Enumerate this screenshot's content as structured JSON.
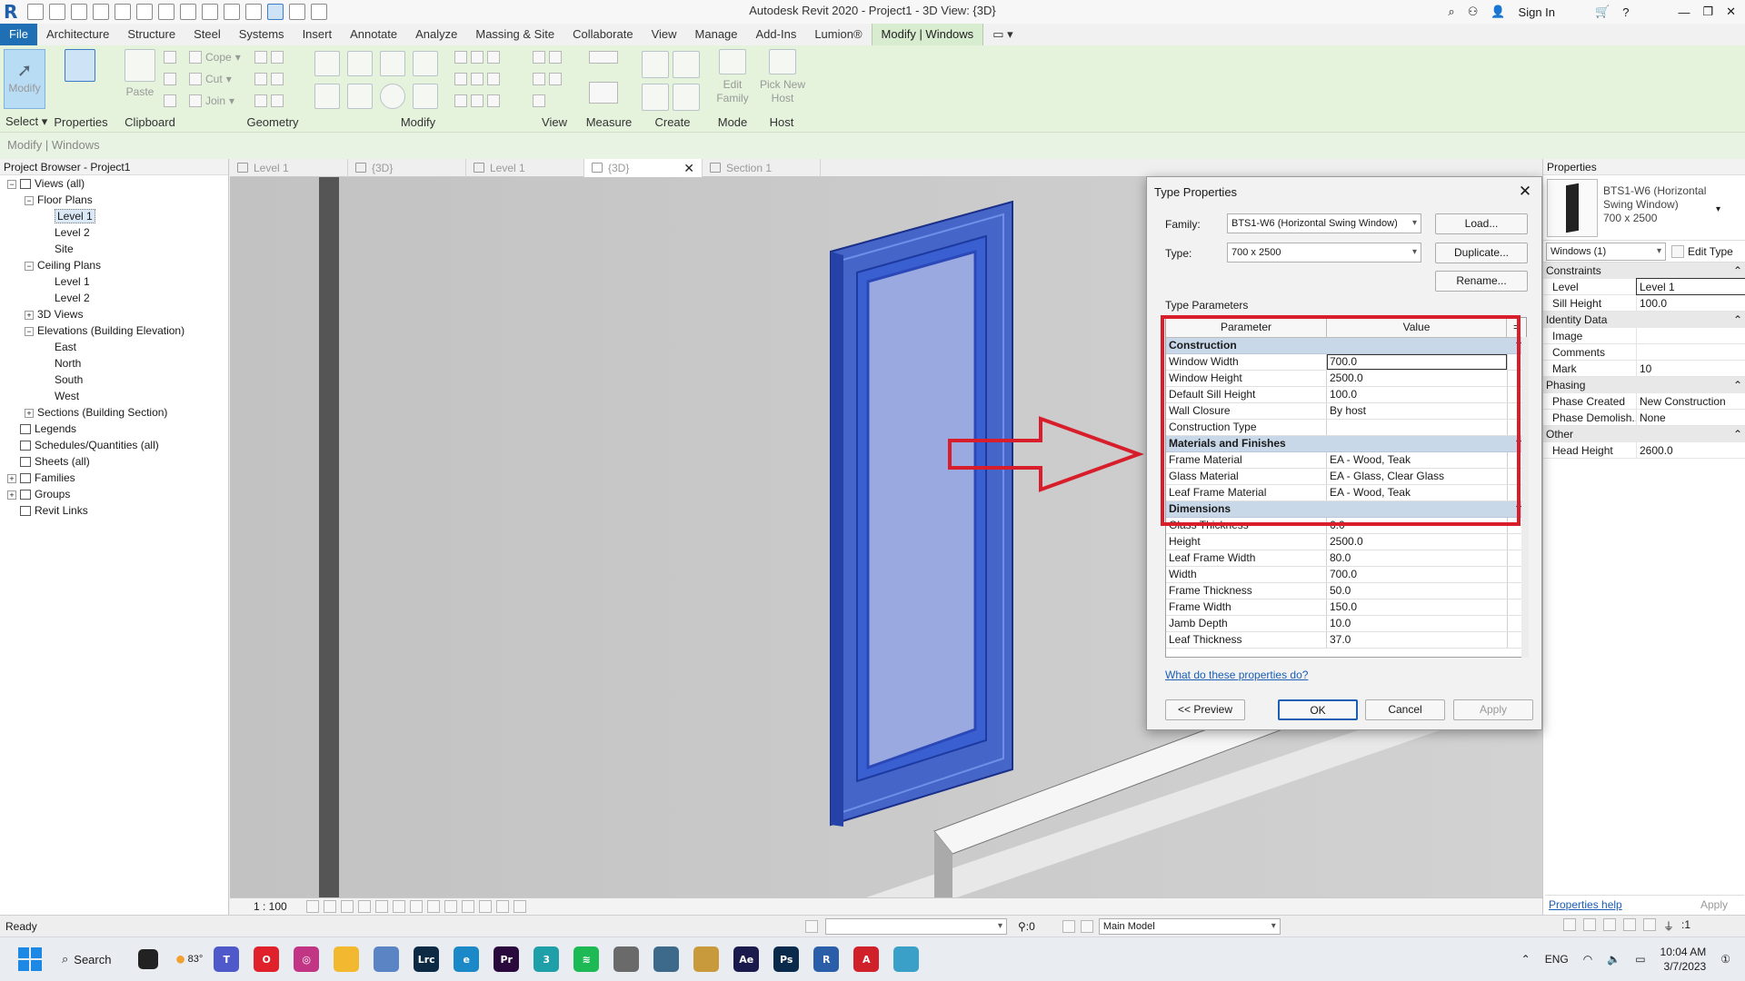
{
  "app": {
    "title": "Autodesk Revit 2020 - Project1 - 3D View: {3D}",
    "logo": "R",
    "sign_in": "Sign In"
  },
  "menu": {
    "items": [
      "File",
      "Architecture",
      "Structure",
      "Steel",
      "Systems",
      "Insert",
      "Annotate",
      "Analyze",
      "Massing & Site",
      "Collaborate",
      "View",
      "Manage",
      "Add-Ins",
      "Lumion®",
      "Modify | Windows"
    ]
  },
  "ribbon": {
    "select_label": "Select",
    "modify_btn": "Modify",
    "properties_label": "Properties",
    "paste_label": "Paste",
    "clipboard_label": "Clipboard",
    "cope": "Cope",
    "cut": "Cut",
    "join": "Join",
    "geometry_label": "Geometry",
    "modify_label": "Modify",
    "view_label": "View",
    "measure_label": "Measure",
    "create_label": "Create",
    "edit_family": "Edit Family",
    "mode_label": "Mode",
    "pick_new_host": "Pick New Host",
    "host_label": "Host"
  },
  "context_bar": "Modify | Windows",
  "project_browser": {
    "title": "Project Browser - Project1",
    "nodes": [
      {
        "label": "Views (all)",
        "level": 0,
        "exp": "−",
        "icon": true
      },
      {
        "label": "Floor Plans",
        "level": 1,
        "exp": "−"
      },
      {
        "label": "Level 1",
        "level": 2,
        "selected": true
      },
      {
        "label": "Level 2",
        "level": 2
      },
      {
        "label": "Site",
        "level": 2
      },
      {
        "label": "Ceiling Plans",
        "level": 1,
        "exp": "−"
      },
      {
        "label": "Level 1",
        "level": 2
      },
      {
        "label": "Level 2",
        "level": 2
      },
      {
        "label": "3D Views",
        "level": 1,
        "exp": "+"
      },
      {
        "label": "Elevations (Building Elevation)",
        "level": 1,
        "exp": "−"
      },
      {
        "label": "East",
        "level": 2
      },
      {
        "label": "North",
        "level": 2
      },
      {
        "label": "South",
        "level": 2
      },
      {
        "label": "West",
        "level": 2
      },
      {
        "label": "Sections (Building Section)",
        "level": 1,
        "exp": "+"
      },
      {
        "label": "Legends",
        "level": 0,
        "icon": true
      },
      {
        "label": "Schedules/Quantities (all)",
        "level": 0,
        "icon": true
      },
      {
        "label": "Sheets (all)",
        "level": 0,
        "icon": true
      },
      {
        "label": "Families",
        "level": 0,
        "exp": "+",
        "icon": true
      },
      {
        "label": "Groups",
        "level": 0,
        "exp": "+",
        "icon": true
      },
      {
        "label": "Revit Links",
        "level": 0,
        "icon": true
      }
    ]
  },
  "view_tabs": [
    "Level 1",
    "{3D}",
    "Level 1",
    "{3D}",
    "Section 1"
  ],
  "view_control": {
    "scale": "1 : 100"
  },
  "dialog": {
    "title": "Type Properties",
    "family_label": "Family:",
    "family_value": "BTS1-W6 (Horizontal Swing Window)",
    "type_label": "Type:",
    "type_value": "700 x 2500",
    "load_btn": "Load...",
    "duplicate_btn": "Duplicate...",
    "rename_btn": "Rename...",
    "type_parameters_label": "Type Parameters",
    "col_parameter": "Parameter",
    "col_value": "Value",
    "col_extra": "=",
    "sections": [
      {
        "name": "Construction",
        "rows": [
          {
            "k": "Window Width",
            "v": "700.0",
            "editing": true
          },
          {
            "k": "Window Height",
            "v": "2500.0"
          },
          {
            "k": "Default Sill Height",
            "v": "100.0"
          },
          {
            "k": "Wall Closure",
            "v": "By host"
          },
          {
            "k": "Construction Type",
            "v": ""
          }
        ]
      },
      {
        "name": "Materials and Finishes",
        "rows": [
          {
            "k": "Frame Material",
            "v": "EA - Wood, Teak"
          },
          {
            "k": "Glass Material",
            "v": "EA - Glass, Clear Glass"
          },
          {
            "k": "Leaf Frame Material",
            "v": "EA - Wood, Teak"
          }
        ]
      },
      {
        "name": "Dimensions",
        "rows": [
          {
            "k": "Glass Thickness",
            "v": "6.0"
          },
          {
            "k": "Height",
            "v": "2500.0"
          },
          {
            "k": "Leaf Frame Width",
            "v": "80.0"
          },
          {
            "k": "Width",
            "v": "700.0"
          },
          {
            "k": "Frame Thickness",
            "v": "50.0"
          },
          {
            "k": "Frame Width",
            "v": "150.0"
          },
          {
            "k": "Jamb Depth",
            "v": "10.0"
          },
          {
            "k": "Leaf Thickness",
            "v": "37.0"
          }
        ]
      }
    ],
    "help_link": "What do these properties do?",
    "preview_btn": "<< Preview",
    "ok_btn": "OK",
    "cancel_btn": "Cancel",
    "apply_btn": "Apply"
  },
  "properties": {
    "title": "Properties",
    "type_name": "BTS1-W6 (Horizontal Swing Window)",
    "type_size": "700 x 2500",
    "selector": "Windows (1)",
    "edit_type": "Edit Type",
    "sections": [
      {
        "name": "Constraints",
        "rows": [
          {
            "k": "Level",
            "v": "Level 1",
            "boxed": true
          },
          {
            "k": "Sill Height",
            "v": "100.0"
          }
        ]
      },
      {
        "name": "Identity Data",
        "rows": [
          {
            "k": "Image",
            "v": ""
          },
          {
            "k": "Comments",
            "v": ""
          },
          {
            "k": "Mark",
            "v": "10"
          }
        ]
      },
      {
        "name": "Phasing",
        "rows": [
          {
            "k": "Phase Created",
            "v": "New Construction"
          },
          {
            "k": "Phase Demolish...",
            "v": "None"
          }
        ]
      },
      {
        "name": "Other",
        "rows": [
          {
            "k": "Head Height",
            "v": "2600.0"
          }
        ]
      }
    ],
    "help_link": "Properties help",
    "apply": "Apply"
  },
  "status": {
    "text": "Ready",
    "workset_count": ":0",
    "model": "Main Model",
    "filter_count": ":1"
  },
  "taskbar": {
    "search": "Search",
    "temperature": "83°",
    "language": "ENG",
    "time": "10:04 AM",
    "date": "3/7/2023",
    "apps": [
      {
        "name": "opera",
        "color": "#e0202a",
        "t": "O"
      },
      {
        "name": "instagram",
        "color": "#c13584",
        "t": "◎"
      },
      {
        "name": "file-explorer",
        "color": "#f2b830",
        "t": ""
      },
      {
        "name": "photos",
        "color": "#5a84c4",
        "t": ""
      },
      {
        "name": "lightroom",
        "color": "#0c2a44",
        "t": "Lrc"
      },
      {
        "name": "edge",
        "color": "#1b88c8",
        "t": "e"
      },
      {
        "name": "premiere",
        "color": "#2a0a3c",
        "t": "Pr"
      },
      {
        "name": "3ds-max",
        "color": "#1fa0a8",
        "t": "3"
      },
      {
        "name": "spotify",
        "color": "#1db954",
        "t": "≋"
      },
      {
        "name": "app-a",
        "color": "#6a6a6a",
        "t": ""
      },
      {
        "name": "app-b",
        "color": "#3d6a8a",
        "t": ""
      },
      {
        "name": "app-c",
        "color": "#c89a3c",
        "t": ""
      },
      {
        "name": "after-effects",
        "color": "#1a1a4c",
        "t": "Ae"
      },
      {
        "name": "photoshop",
        "color": "#0a2a4c",
        "t": "Ps"
      },
      {
        "name": "revit",
        "color": "#2a5ea8",
        "t": "R"
      },
      {
        "name": "acrobat",
        "color": "#d0202a",
        "t": "A"
      },
      {
        "name": "globe-app",
        "color": "#3aa0c8",
        "t": ""
      }
    ]
  },
  "colors": {
    "ribbon_bg": "#e5f2dc",
    "file_tab": "#1e6fb4",
    "window_selected": "#2f53c8",
    "annotation_red": "#d81e2a"
  }
}
